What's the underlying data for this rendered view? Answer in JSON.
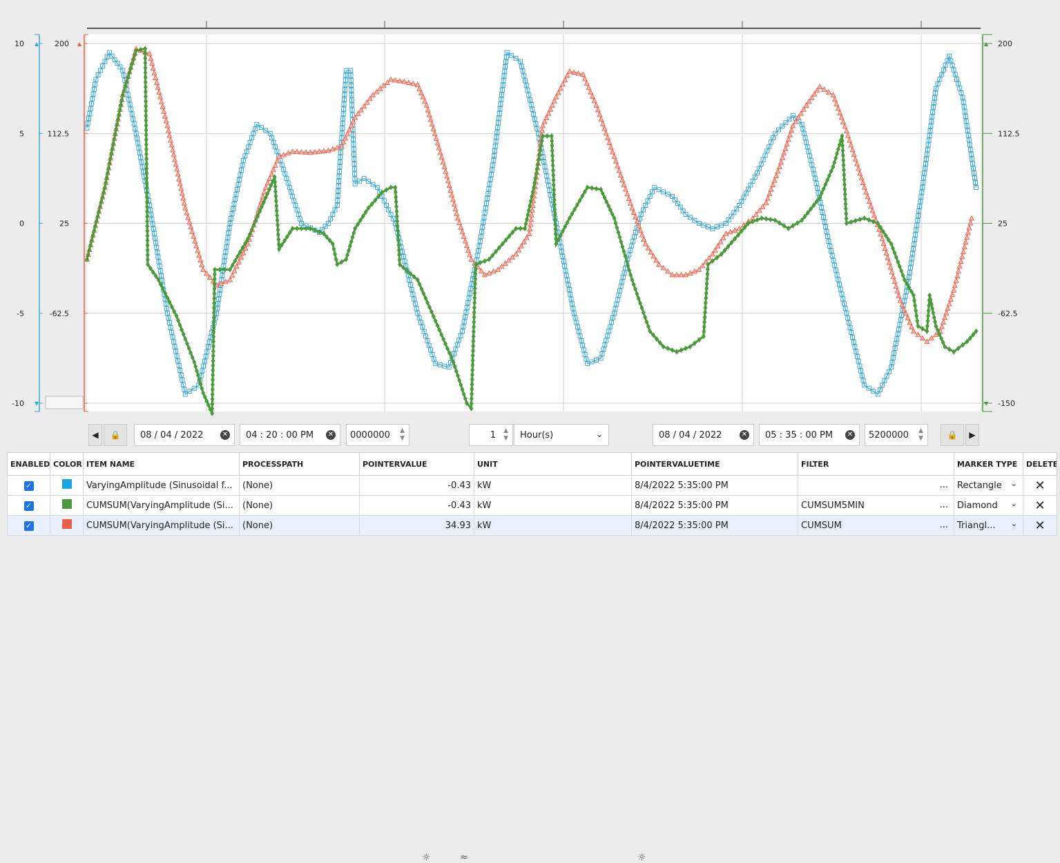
{
  "chart_data": {
    "type": "line",
    "axes": {
      "left_outer": {
        "ticks": [
          "10",
          "5",
          "0",
          "-5",
          "-10"
        ],
        "color": "#3aa8d8",
        "ylim": [
          -10,
          10
        ]
      },
      "left_inner": {
        "ticks": [
          "200",
          "112.5",
          "25",
          "-62.5",
          "-150"
        ],
        "color": "#e8604c",
        "ylim": [
          -150,
          200
        ]
      },
      "right": {
        "ticks": [
          "200",
          "112.5",
          "25",
          "-62.5",
          "-150"
        ],
        "color": "#4a9a3c",
        "ylim": [
          -150,
          200
        ]
      }
    },
    "grid": true,
    "xlim": [
      0,
      1
    ],
    "series": [
      {
        "color": "#3aa8d8",
        "marker": "square",
        "axis": "left_outer",
        "points": [
          [
            0.0,
            5.3
          ],
          [
            0.01,
            8.0
          ],
          [
            0.025,
            9.5
          ],
          [
            0.04,
            8.5
          ],
          [
            0.055,
            5.0
          ],
          [
            0.07,
            1.0
          ],
          [
            0.09,
            -5.0
          ],
          [
            0.11,
            -9.5
          ],
          [
            0.125,
            -9.0
          ],
          [
            0.145,
            -5.0
          ],
          [
            0.16,
            0.0
          ],
          [
            0.175,
            3.5
          ],
          [
            0.19,
            5.5
          ],
          [
            0.205,
            5.0
          ],
          [
            0.22,
            3.0
          ],
          [
            0.24,
            0.0
          ],
          [
            0.26,
            -0.5
          ],
          [
            0.27,
            0.0
          ],
          [
            0.28,
            1.0
          ],
          [
            0.29,
            8.5
          ],
          [
            0.295,
            8.5
          ],
          [
            0.3,
            2.2
          ],
          [
            0.31,
            2.5
          ],
          [
            0.325,
            2.0
          ],
          [
            0.345,
            0.0
          ],
          [
            0.37,
            -5.0
          ],
          [
            0.39,
            -7.8
          ],
          [
            0.405,
            -8.0
          ],
          [
            0.42,
            -6.0
          ],
          [
            0.44,
            -1.0
          ],
          [
            0.455,
            3.5
          ],
          [
            0.47,
            9.5
          ],
          [
            0.485,
            9.0
          ],
          [
            0.505,
            5.0
          ],
          [
            0.525,
            0.0
          ],
          [
            0.545,
            -5.0
          ],
          [
            0.56,
            -7.8
          ],
          [
            0.575,
            -7.5
          ],
          [
            0.59,
            -5.0
          ],
          [
            0.605,
            -2.0
          ],
          [
            0.62,
            0.5
          ],
          [
            0.635,
            2.0
          ],
          [
            0.655,
            1.5
          ],
          [
            0.67,
            0.5
          ],
          [
            0.685,
            0.0
          ],
          [
            0.7,
            -0.3
          ],
          [
            0.715,
            0.0
          ],
          [
            0.73,
            1.0
          ],
          [
            0.75,
            2.8
          ],
          [
            0.77,
            5.0
          ],
          [
            0.79,
            6.0
          ],
          [
            0.8,
            5.5
          ],
          [
            0.815,
            2.5
          ],
          [
            0.83,
            -1.0
          ],
          [
            0.85,
            -5.0
          ],
          [
            0.87,
            -9.0
          ],
          [
            0.885,
            -9.5
          ],
          [
            0.9,
            -8.0
          ],
          [
            0.92,
            -3.0
          ],
          [
            0.935,
            2.0
          ],
          [
            0.95,
            7.5
          ],
          [
            0.965,
            9.3
          ],
          [
            0.98,
            7.0
          ],
          [
            0.995,
            2.0
          ],
          [
            1.01,
            -2.0
          ],
          [
            1.02,
            -4.0
          ],
          [
            1.035,
            -4.5
          ],
          [
            1.05,
            -3.0
          ],
          [
            1.07,
            -1.0
          ],
          [
            1.085,
            0.3
          ]
        ]
      },
      {
        "color": "#e8604c",
        "marker": "triangle",
        "axis": "left_inner",
        "points": [
          [
            0.0,
            -10
          ],
          [
            0.02,
            60
          ],
          [
            0.04,
            150
          ],
          [
            0.055,
            195
          ],
          [
            0.07,
            190
          ],
          [
            0.09,
            120
          ],
          [
            0.11,
            40
          ],
          [
            0.13,
            -20
          ],
          [
            0.145,
            -35
          ],
          [
            0.16,
            -30
          ],
          [
            0.18,
            5
          ],
          [
            0.2,
            60
          ],
          [
            0.215,
            90
          ],
          [
            0.23,
            95
          ],
          [
            0.25,
            94
          ],
          [
            0.27,
            96
          ],
          [
            0.285,
            100
          ],
          [
            0.3,
            128
          ],
          [
            0.32,
            150
          ],
          [
            0.34,
            165
          ],
          [
            0.355,
            163
          ],
          [
            0.37,
            160
          ],
          [
            0.38,
            140
          ],
          [
            0.4,
            80
          ],
          [
            0.415,
            30
          ],
          [
            0.43,
            -10
          ],
          [
            0.445,
            -25
          ],
          [
            0.46,
            -20
          ],
          [
            0.48,
            -5
          ],
          [
            0.495,
            15
          ],
          [
            0.51,
            120
          ],
          [
            0.525,
            148
          ],
          [
            0.54,
            173
          ],
          [
            0.555,
            170
          ],
          [
            0.57,
            140
          ],
          [
            0.59,
            90
          ],
          [
            0.61,
            40
          ],
          [
            0.625,
            5
          ],
          [
            0.64,
            -15
          ],
          [
            0.655,
            -25
          ],
          [
            0.67,
            -25
          ],
          [
            0.685,
            -20
          ],
          [
            0.7,
            -5
          ],
          [
            0.715,
            15
          ],
          [
            0.73,
            20
          ],
          [
            0.745,
            30
          ],
          [
            0.76,
            45
          ],
          [
            0.775,
            80
          ],
          [
            0.79,
            120
          ],
          [
            0.805,
            140
          ],
          [
            0.82,
            158
          ],
          [
            0.835,
            150
          ],
          [
            0.85,
            115
          ],
          [
            0.87,
            60
          ],
          [
            0.89,
            10
          ],
          [
            0.91,
            -50
          ],
          [
            0.925,
            -80
          ],
          [
            0.94,
            -90
          ],
          [
            0.955,
            -80
          ],
          [
            0.97,
            -40
          ],
          [
            0.99,
            30
          ],
          [
            1.01,
            95
          ],
          [
            1.025,
            123
          ],
          [
            1.04,
            118
          ],
          [
            1.06,
            80
          ],
          [
            1.08,
            45
          ],
          [
            1.095,
            37
          ]
        ]
      },
      {
        "color": "#4a9a3c",
        "marker": "diamond",
        "axis": "right",
        "points": [
          [
            0.0,
            -10
          ],
          [
            0.02,
            60
          ],
          [
            0.04,
            150
          ],
          [
            0.055,
            193
          ],
          [
            0.065,
            195
          ],
          [
            0.068,
            -15
          ],
          [
            0.08,
            -30
          ],
          [
            0.1,
            -65
          ],
          [
            0.12,
            -110
          ],
          [
            0.13,
            -140
          ],
          [
            0.14,
            -160
          ],
          [
            0.143,
            -20
          ],
          [
            0.16,
            -20
          ],
          [
            0.18,
            10
          ],
          [
            0.2,
            50
          ],
          [
            0.21,
            70
          ],
          [
            0.215,
            0
          ],
          [
            0.23,
            20
          ],
          [
            0.25,
            20
          ],
          [
            0.265,
            15
          ],
          [
            0.275,
            5
          ],
          [
            0.28,
            -15
          ],
          [
            0.29,
            -10
          ],
          [
            0.3,
            20
          ],
          [
            0.315,
            40
          ],
          [
            0.33,
            55
          ],
          [
            0.34,
            60
          ],
          [
            0.345,
            60
          ],
          [
            0.35,
            -15
          ],
          [
            0.37,
            -30
          ],
          [
            0.39,
            -70
          ],
          [
            0.41,
            -110
          ],
          [
            0.425,
            -150
          ],
          [
            0.43,
            -155
          ],
          [
            0.435,
            -15
          ],
          [
            0.45,
            -10
          ],
          [
            0.465,
            5
          ],
          [
            0.48,
            20
          ],
          [
            0.49,
            20
          ],
          [
            0.5,
            60
          ],
          [
            0.51,
            110
          ],
          [
            0.52,
            110
          ],
          [
            0.525,
            5
          ],
          [
            0.54,
            30
          ],
          [
            0.56,
            60
          ],
          [
            0.575,
            58
          ],
          [
            0.59,
            30
          ],
          [
            0.61,
            -30
          ],
          [
            0.63,
            -80
          ],
          [
            0.645,
            -95
          ],
          [
            0.66,
            -100
          ],
          [
            0.675,
            -95
          ],
          [
            0.69,
            -85
          ],
          [
            0.695,
            -15
          ],
          [
            0.71,
            -5
          ],
          [
            0.725,
            10
          ],
          [
            0.74,
            25
          ],
          [
            0.755,
            30
          ],
          [
            0.77,
            28
          ],
          [
            0.785,
            20
          ],
          [
            0.8,
            28
          ],
          [
            0.82,
            50
          ],
          [
            0.835,
            80
          ],
          [
            0.845,
            110
          ],
          [
            0.85,
            25
          ],
          [
            0.87,
            30
          ],
          [
            0.885,
            25
          ],
          [
            0.9,
            5
          ],
          [
            0.915,
            -30
          ],
          [
            0.925,
            -45
          ],
          [
            0.93,
            -75
          ],
          [
            0.94,
            -80
          ],
          [
            0.943,
            -45
          ],
          [
            0.95,
            -75
          ],
          [
            0.96,
            -95
          ],
          [
            0.97,
            -100
          ],
          [
            0.985,
            -90
          ],
          [
            0.995,
            -80
          ],
          [
            1.005,
            -50
          ],
          [
            1.02,
            0
          ],
          [
            1.035,
            50
          ],
          [
            1.05,
            110
          ],
          [
            1.065,
            150
          ],
          [
            1.08,
            170
          ],
          [
            1.09,
            165
          ],
          [
            1.095,
            122
          ],
          [
            1.0955,
            -15
          ],
          [
            1.11,
            -30
          ],
          [
            1.13,
            -60
          ],
          [
            1.15,
            -80
          ],
          [
            1.17,
            -93
          ],
          [
            1.18,
            -95
          ],
          [
            1.182,
            -15
          ]
        ]
      }
    ]
  },
  "toolbar": {
    "start_date": "08 / 04 / 2022",
    "start_time": "04 : 20 : 00  PM",
    "start_ms": "0000000",
    "interval_value": "1",
    "interval_unit": "Hour(s)",
    "end_date": "08 / 04 / 2022",
    "end_time": "05 : 35 : 00  PM",
    "end_ms": "5200000"
  },
  "table": {
    "headers": [
      "ENABLED",
      "COLOR",
      "ITEM NAME",
      "PROCESSPATH",
      "POINTERVALUE",
      "UNIT",
      "POINTERVALUETIME",
      "FILTER",
      "MARKER TYPE",
      "DELETE"
    ],
    "rows": [
      {
        "color": "#1aa3e0",
        "item": "VaryingAmplitude (Sinusoidal f...",
        "path": "(None)",
        "value": "-0.43",
        "unit": "kW",
        "time": "8/4/2022 5:35:00 PM",
        "filter": "",
        "marker": "Rectangle"
      },
      {
        "color": "#4a9a3c",
        "item": "CUMSUM(VaryingAmplitude (Si...",
        "path": "(None)",
        "value": "-0.43",
        "unit": "kW",
        "time": "8/4/2022 5:35:00 PM",
        "filter": "CUMSUM5MIN",
        "marker": "Diamond"
      },
      {
        "color": "#e8604c",
        "item": "CUMSUM(VaryingAmplitude (Si...",
        "path": "(None)",
        "value": "34.93",
        "unit": "kW",
        "time": "8/4/2022 5:35:00 PM",
        "filter": "CUMSUM",
        "marker": "Triangl..."
      }
    ],
    "dots": "...",
    "delete_glyph": "✕"
  }
}
